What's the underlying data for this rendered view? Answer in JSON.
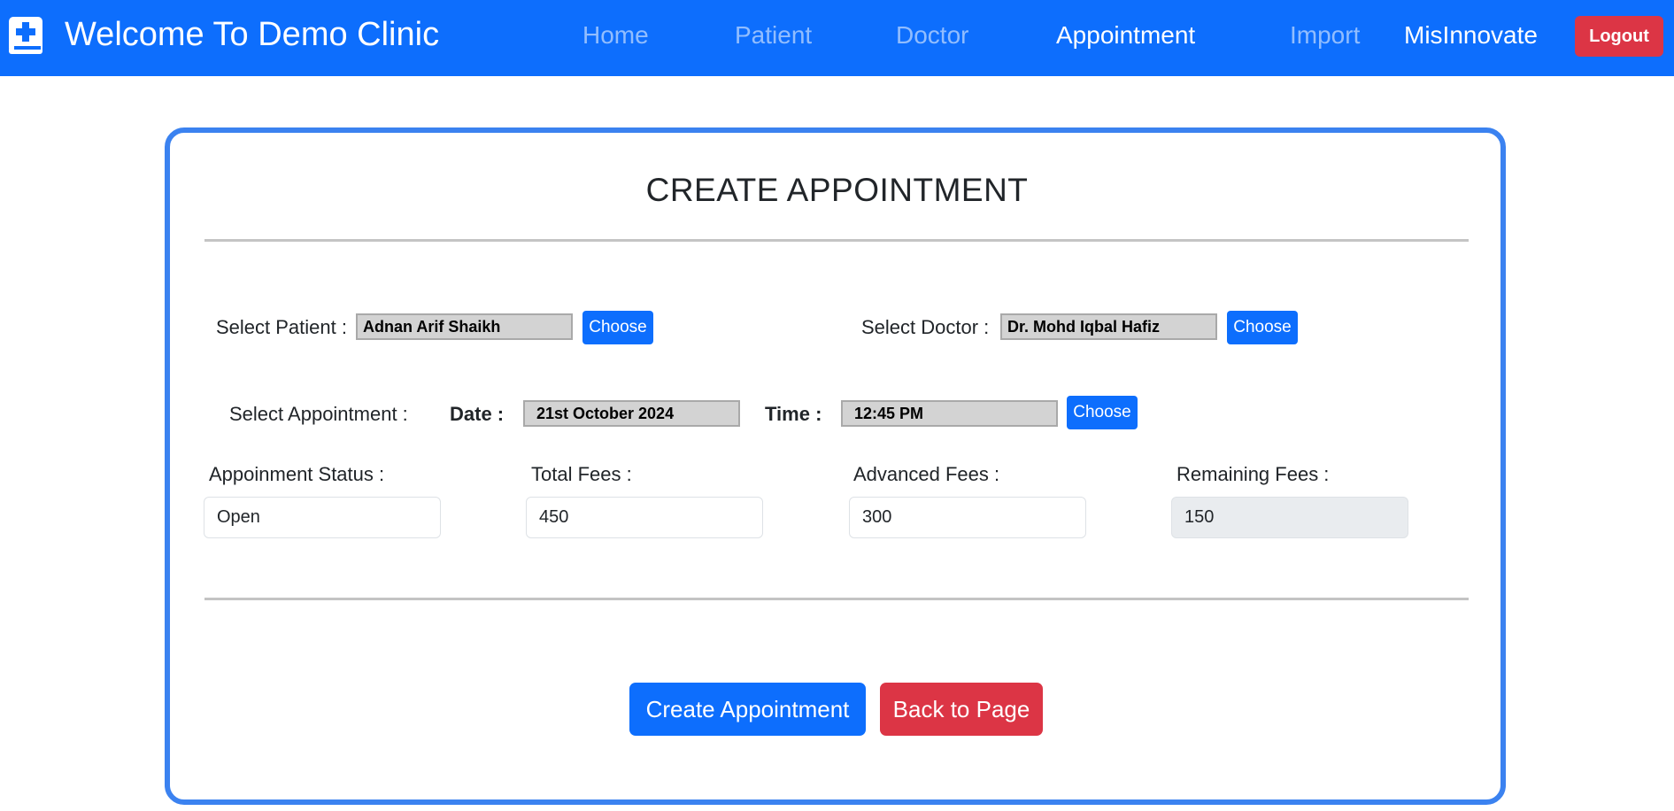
{
  "navbar": {
    "brand_icon": "medical-book-icon",
    "title": "Welcome To Demo Clinic",
    "links": [
      {
        "label": "Home",
        "active": false
      },
      {
        "label": "Patient",
        "active": false
      },
      {
        "label": "Doctor",
        "active": false
      },
      {
        "label": "Appointment",
        "active": true
      },
      {
        "label": "Import",
        "active": false
      }
    ],
    "user": "MisInnovate",
    "logout_label": "Logout",
    "color": "#0d6efd"
  },
  "form": {
    "title": "CREATE APPOINTMENT",
    "patient": {
      "label": "Select Patient :",
      "value": "Adnan Arif Shaikh",
      "button": "Choose"
    },
    "doctor": {
      "label": "Select Doctor :",
      "value": "Dr. Mohd Iqbal Hafiz",
      "button": "Choose"
    },
    "appointment": {
      "label": "Select Appointment :",
      "date_label": "Date :",
      "date_value": "21st October 2024",
      "time_label": "Time :",
      "time_value": "12:45 PM",
      "button": "Choose"
    },
    "status": {
      "label": "Appoinment Status :",
      "value": "Open"
    },
    "total_fees": {
      "label": "Total Fees :",
      "value": "450"
    },
    "advanced_fees": {
      "label": "Advanced Fees :",
      "value": "300"
    },
    "remaining_fees": {
      "label": "Remaining Fees :",
      "value": "150"
    },
    "create_button": "Create Appointment",
    "back_button": "Back to Page"
  },
  "colors": {
    "primary": "#0d6efd",
    "danger": "#dc3545",
    "card_border": "#3b82f0"
  }
}
